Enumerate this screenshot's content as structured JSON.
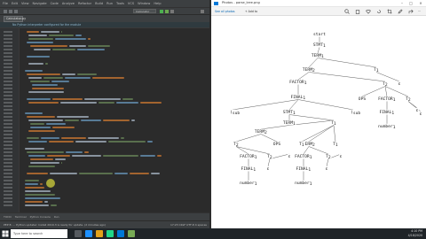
{
  "ide": {
    "menu": [
      "File",
      "Edit",
      "View",
      "Navigate",
      "Code",
      "Analyze",
      "Refactor",
      "Build",
      "Run",
      "Tools",
      "VCS",
      "Window",
      "Help"
    ],
    "run_config": "Calculator",
    "file_tab": "Calculator.py",
    "banner": "No Python interpreter configured for the module",
    "bottom_tabs": [
      "TODO",
      "Terminal",
      "Python Console",
      "Run"
    ],
    "status_left": "PEP 8: ... Python updater: Install 2019.3 is ready for update. (2 minutes ago)",
    "status_right": "17:23  CRLF  UTF-8  4 spaces"
  },
  "viewer": {
    "title": "Photos - parse_tree.png",
    "toolbar": {
      "see_all": "See all photos",
      "add": "+ Add to"
    }
  },
  "tree": {
    "nodes": [
      {
        "id": "start",
        "label": "start",
        "sub": ""
      },
      {
        "id": "stmt1",
        "label": "STMT",
        "sub": "1"
      },
      {
        "id": "term1",
        "label": "TERM",
        "sub": "1"
      },
      {
        "id": "term2",
        "label": "TERM",
        "sub": "2"
      },
      {
        "id": "t1a",
        "label": "T",
        "sub": "1"
      },
      {
        "id": "eps1",
        "label": "ε",
        "sub": ""
      },
      {
        "id": "factor1",
        "label": "FACTOR",
        "sub": "1"
      },
      {
        "id": "t2a",
        "label": "T",
        "sub": "2"
      },
      {
        "id": "final1",
        "label": "FINAL",
        "sub": "1"
      },
      {
        "id": "ops1",
        "label": "OPS",
        "sub": ""
      },
      {
        "id": "factor2",
        "label": "FACTOR",
        "sub": "1"
      },
      {
        "id": "t2b",
        "label": "T",
        "sub": "2"
      },
      {
        "id": "eps2",
        "label": "ε",
        "sub": ""
      },
      {
        "id": "lpar",
        "label": "(",
        "sub": "sub"
      },
      {
        "id": "stmt2",
        "label": "STMT",
        "sub": "1"
      },
      {
        "id": "rpar",
        "label": ")",
        "sub": "sub"
      },
      {
        "id": "final2",
        "label": "FINAL",
        "sub": "1"
      },
      {
        "id": "eps3",
        "label": "ε",
        "sub": ""
      },
      {
        "id": "number1",
        "label": "number",
        "sub": "1"
      },
      {
        "id": "term3",
        "label": "TERM",
        "sub": "1"
      },
      {
        "id": "t1b",
        "label": "T",
        "sub": "1"
      },
      {
        "id": "term4",
        "label": "TERM",
        "sub": "2"
      },
      {
        "id": "t2c",
        "label": "T",
        "sub": "2"
      },
      {
        "id": "ops2",
        "label": "OPS",
        "sub": ""
      },
      {
        "id": "term5",
        "label": "TERM",
        "sub": "2"
      },
      {
        "id": "t1c",
        "label": "T",
        "sub": "1"
      },
      {
        "id": "t1d",
        "label": "T",
        "sub": "1"
      },
      {
        "id": "factor3",
        "label": "FACTOR",
        "sub": "1"
      },
      {
        "id": "t3a",
        "label": "T",
        "sub": "2"
      },
      {
        "id": "eps4",
        "label": "ε",
        "sub": ""
      },
      {
        "id": "factor4",
        "label": "FACTOR",
        "sub": "1"
      },
      {
        "id": "t3b",
        "label": "T",
        "sub": "2"
      },
      {
        "id": "eps5",
        "label": "ε",
        "sub": ""
      },
      {
        "id": "final3",
        "label": "FINAL",
        "sub": "1"
      },
      {
        "id": "eps6",
        "label": "ε",
        "sub": ""
      },
      {
        "id": "final4",
        "label": "FINAL",
        "sub": "1"
      },
      {
        "id": "eps7",
        "label": "ε",
        "sub": ""
      },
      {
        "id": "number2",
        "label": "number",
        "sub": "1"
      },
      {
        "id": "number3",
        "label": "number",
        "sub": "1"
      }
    ]
  },
  "taskbar": {
    "search_placeholder": "Type here to search",
    "time": "4:10 PM",
    "date": "4/18/2020"
  },
  "colors": {
    "ide_bg": "#2b2b2b",
    "keyword": "#cc7832",
    "string": "#6a8759",
    "number": "#6897bb",
    "text": "#a9b7c6",
    "highlight": "#d2d23c"
  }
}
